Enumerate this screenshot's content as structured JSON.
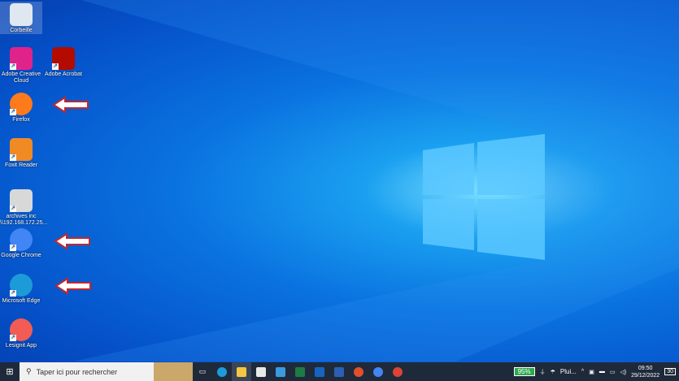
{
  "desktop": {
    "icons": [
      {
        "label": "Corbeille",
        "icon": "recycle-bin-icon",
        "color": "#dfe8f0"
      },
      {
        "label": "Adobe Creative Cloud",
        "icon": "creative-cloud-icon",
        "color": "#e0238a"
      },
      {
        "label": "Adobe Acrobat",
        "icon": "acrobat-icon",
        "color": "#b30b00"
      },
      {
        "label": "Firefox",
        "icon": "firefox-icon",
        "color": "#ff7a1a"
      },
      {
        "label": "Foxit Reader",
        "icon": "foxit-icon",
        "color": "#f08a24"
      },
      {
        "label": "archives inc \\\\192.168.172.25...",
        "icon": "network-drive-icon",
        "color": "#d8d8d8"
      },
      {
        "label": "Google Chrome",
        "icon": "chrome-icon",
        "color": "#4285f4"
      },
      {
        "label": "Microsoft Edge",
        "icon": "edge-icon",
        "color": "#1d9bd8"
      },
      {
        "label": "Lesignit App",
        "icon": "lesignit-icon",
        "color": "#f25c54"
      }
    ]
  },
  "taskbar": {
    "search_placeholder": "Taper ici pour rechercher",
    "battery": "95%",
    "weather": "Plui...",
    "time": "09:50",
    "date": "29/12/2022",
    "notifications": "30"
  }
}
